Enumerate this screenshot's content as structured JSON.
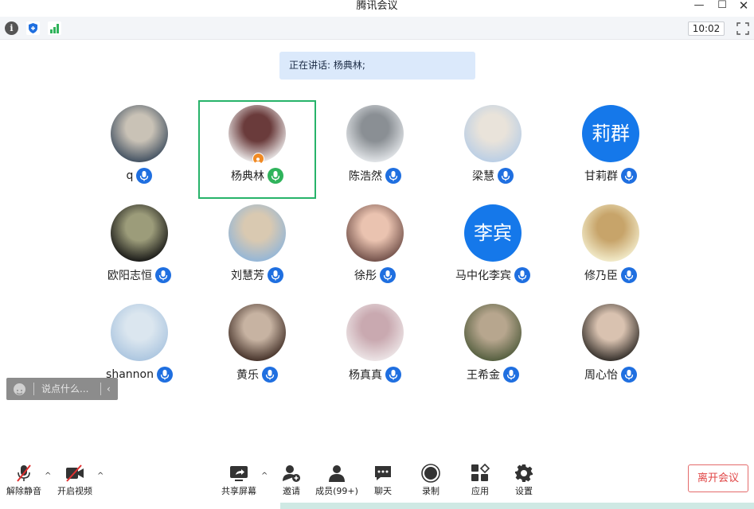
{
  "window": {
    "title": "腾讯会议",
    "minimize": "—",
    "maximize": "☐",
    "close": "✕"
  },
  "toolbar": {
    "clock": "10:02",
    "info_glyph": "i"
  },
  "speaking": {
    "label": "正在讲话: 杨典林;"
  },
  "participants": [
    {
      "name": "q",
      "avatar": "photo-cat",
      "mic": "blue"
    },
    {
      "name": "杨典林",
      "avatar": "photo-girl-back",
      "mic": "green",
      "active": true,
      "host": true
    },
    {
      "name": "陈浩然",
      "avatar": "photo-snow",
      "mic": "blue"
    },
    {
      "name": "梁慧",
      "avatar": "photo-woman",
      "mic": "blue"
    },
    {
      "name": "甘莉群",
      "avatar_text": "莉群",
      "mic": "blue"
    },
    {
      "name": "欧阳志恒",
      "avatar": "photo-astronaut",
      "mic": "blue"
    },
    {
      "name": "刘慧芳",
      "avatar": "photo-town",
      "mic": "blue"
    },
    {
      "name": "徐彤",
      "avatar": "photo-laugh",
      "mic": "blue"
    },
    {
      "name": "马中化李宾",
      "avatar_text": "李宾",
      "mic": "blue"
    },
    {
      "name": "修乃臣",
      "avatar": "photo-cartoon",
      "mic": "blue"
    },
    {
      "name": "shannon",
      "avatar": "photo-sea",
      "mic": "blue"
    },
    {
      "name": "黄乐",
      "avatar": "photo-camera",
      "mic": "blue"
    },
    {
      "name": "杨真真",
      "avatar": "photo-drawing",
      "mic": "blue"
    },
    {
      "name": "王希金",
      "avatar": "photo-men",
      "mic": "blue"
    },
    {
      "name": "周心怡",
      "avatar": "photo-actress",
      "mic": "blue"
    }
  ],
  "chat": {
    "placeholder": "说点什么...",
    "chevron": "‹"
  },
  "bottom": {
    "unmute": "解除静音",
    "start_video": "开启视频",
    "share": "共享屏幕",
    "invite": "邀请",
    "members": "成员(99+)",
    "chat": "聊天",
    "record": "录制",
    "apps": "应用",
    "settings": "设置",
    "leave": "离开会议",
    "caret": "^"
  },
  "colors": {
    "accent": "#1578ea",
    "active_border": "#27b36a",
    "leave": "#e04444",
    "banner": "#dbe9fb"
  }
}
